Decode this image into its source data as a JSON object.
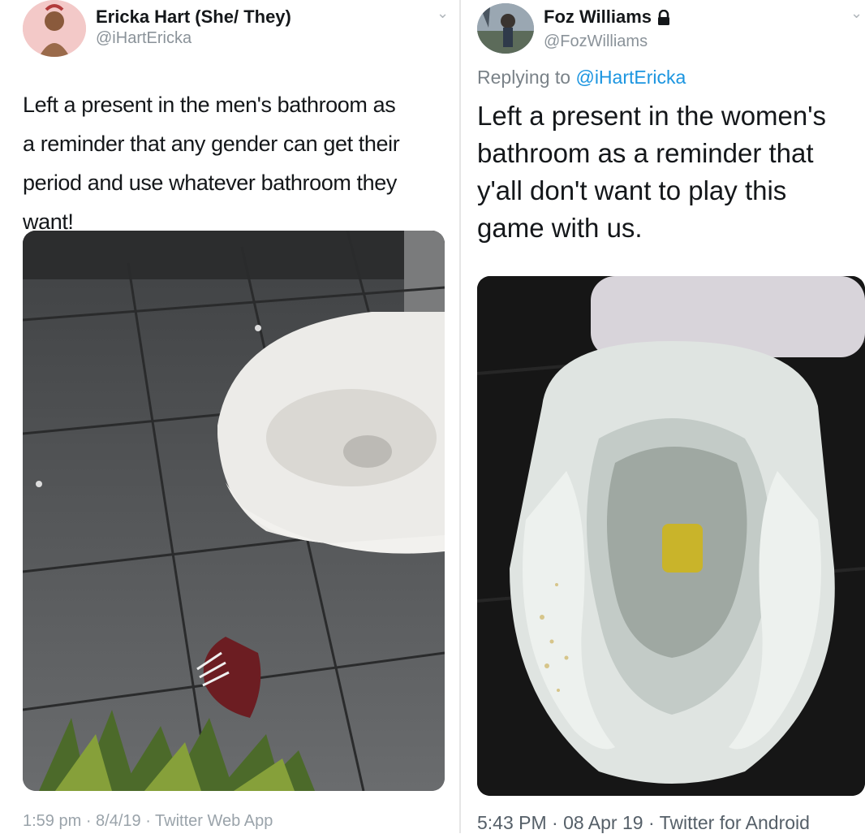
{
  "left_tweet": {
    "author_name": "Ericka Hart (She/ They)",
    "handle": "@iHartEricka",
    "text": "Left a present in the men's bathroom as\na reminder that any gender can get their\nperiod and use whatever bathroom they\nwant!",
    "meta": "1:59 pm · 8/4/19 · Twitter Web App",
    "photo_icon": "toilet-on-tile-floor-photo"
  },
  "right_tweet": {
    "author_name": "Foz Williams",
    "handle": "@FozWilliams",
    "reply_prefix": "Replying to ",
    "reply_mention": "@iHartEricka",
    "text": "Left a present in the women's\nbathroom as a reminder that\ny'all don't want to play this\ngame with us.",
    "meta": "5:43 PM · 08 Apr 19 · Twitter for Android",
    "photo_icon": "toilet-bowl-closeup-photo",
    "verified_icon": "lock-icon"
  },
  "colors": {
    "mention": "#1b95e0",
    "handle_gray": "#8a9299",
    "text": "#14171a"
  }
}
